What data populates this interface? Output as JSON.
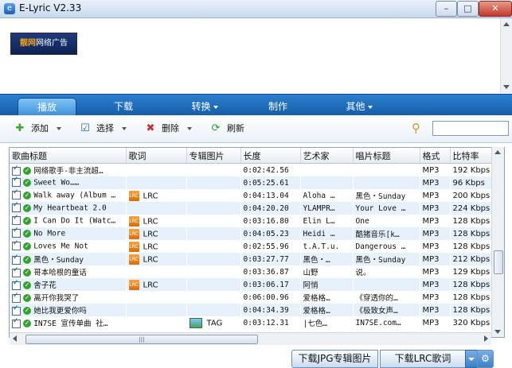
{
  "app": {
    "title": "E-Lyric V2.33"
  },
  "window_controls": {
    "minimize": "–",
    "maximize": "□",
    "close": "✕"
  },
  "ad": {
    "logo_text_a": "靓网",
    "logo_text_b": "网络广告"
  },
  "nav": {
    "tabs": [
      {
        "label": "播放",
        "active": true,
        "dropdown": false
      },
      {
        "label": "下载",
        "active": false,
        "dropdown": false
      },
      {
        "label": "转换",
        "active": false,
        "dropdown": true
      },
      {
        "label": "制作",
        "active": false,
        "dropdown": false
      },
      {
        "label": "其他",
        "active": false,
        "dropdown": true
      }
    ]
  },
  "toolbar": {
    "add_label": "添加",
    "select_label": "选择",
    "delete_label": "删除",
    "refresh_label": "刷新"
  },
  "search": {
    "placeholder": "",
    "value": ""
  },
  "table": {
    "headers": [
      "歌曲标题",
      "歌词",
      "专辑图片",
      "长度",
      "艺术家",
      "唱片标题",
      "格式",
      "比特率"
    ],
    "rows": [
      {
        "title": "网络歌手-非主流超…",
        "lyric": "",
        "art": "",
        "length": "0:02:42.56",
        "artist": "",
        "album": "",
        "format": "MP3",
        "bitrate": "192 Kbps"
      },
      {
        "title": "Sweet Wo……",
        "lyric": "",
        "art": "",
        "length": "0:05:25.61",
        "artist": "",
        "album": "",
        "format": "MP3",
        "bitrate": "96 Kbps"
      },
      {
        "title": "Walk away (Album …",
        "lyric": "LRC",
        "art": "",
        "length": "0:04:13.04",
        "artist": "Aloha …",
        "album": "黑色・Sunday",
        "format": "MP3",
        "bitrate": "200 Kbps"
      },
      {
        "title": "My Heartbeat 2.0",
        "lyric": "",
        "art": "",
        "length": "0:04:20.20",
        "artist": "YLAMPR…",
        "album": "Your Love …",
        "format": "MP3",
        "bitrate": "224 Kbps"
      },
      {
        "title": "I Can Do It (Watc…",
        "lyric": "LRC",
        "art": "",
        "length": "0:03:16.80",
        "artist": "Elin L…",
        "album": "One",
        "format": "MP3",
        "bitrate": "128 Kbps"
      },
      {
        "title": "No More",
        "lyric": "LRC",
        "art": "",
        "length": "0:04:05.23",
        "artist": "Heidi …",
        "album": "酷猪音乐[k…",
        "format": "MP3",
        "bitrate": "128 Kbps"
      },
      {
        "title": "Loves Me Not",
        "lyric": "LRC",
        "art": "",
        "length": "0:02:55.96",
        "artist": "t.A.T.u.",
        "album": "Dangerous …",
        "format": "MP3",
        "bitrate": "128 Kbps"
      },
      {
        "title": "黑色・Sunday",
        "lyric": "LRC",
        "art": "",
        "length": "0:03:27.77",
        "artist": "黑色・…",
        "album": "黑色・Sunday",
        "format": "MP3",
        "bitrate": "212 Kbps"
      },
      {
        "title": "哥本哈根的童话",
        "lyric": "",
        "art": "",
        "length": "0:03:36.87",
        "artist": "山野",
        "album": "说。",
        "format": "MP3",
        "bitrate": "129 Kbps"
      },
      {
        "title": "舍子花",
        "lyric": "LRC",
        "art": "",
        "length": "0:03:06.17",
        "artist": "阿悄",
        "album": "",
        "format": "MP3",
        "bitrate": "128 Kbps"
      },
      {
        "title": "离开你我哭了",
        "lyric": "",
        "art": "",
        "length": "0:06:00.96",
        "artist": "爱格格…",
        "album": "《穿透你的…",
        "format": "MP3",
        "bitrate": "128 Kbps"
      },
      {
        "title": "她比我更爱你吗",
        "lyric": "",
        "art": "",
        "length": "0:04:34.39",
        "artist": "爱格格…",
        "album": "《极致女声…",
        "format": "MP3",
        "bitrate": "128 Kbps"
      },
      {
        "title": "IN7SE 宣传单曲 社…",
        "lyric": "",
        "art": "TAG",
        "length": "0:03:12.31",
        "artist": "|七色…",
        "album": "IN7SE.com…",
        "format": "MP3",
        "bitrate": "320 Kbps"
      }
    ]
  },
  "hscroll": {
    "thumb_label": "|||"
  },
  "buttons": {
    "download_jpg": "下载JPG专辑图片",
    "download_lrc": "下载LRC歌词",
    "gear": "⚙"
  }
}
